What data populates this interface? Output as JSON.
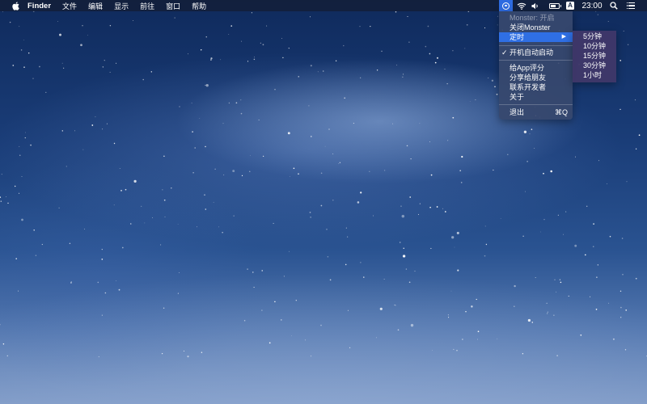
{
  "menubar": {
    "app_name": "Finder",
    "menus": [
      "文件",
      "编辑",
      "显示",
      "前往",
      "窗口",
      "帮助"
    ],
    "status": {
      "input_source": "A",
      "clock": "23:00"
    },
    "icons": [
      "apple-icon",
      "monster-icon",
      "wifi-icon",
      "volume-icon",
      "battery-icon",
      "input-source-icon",
      "spotlight-icon",
      "notification-center-icon"
    ]
  },
  "dropdown": {
    "status_label": "Monster: 开启",
    "close_label": "关闭Monster",
    "timer_label": "定时",
    "autostart_label": "开机自动启动",
    "autostart_checked": true,
    "rate_label": "给App评分",
    "share_label": "分享给朋友",
    "contact_label": "联系开发者",
    "about_label": "关于",
    "quit_label": "退出",
    "quit_shortcut": "⌘Q"
  },
  "submenu": {
    "items": [
      "5分钟",
      "10分钟",
      "15分钟",
      "30分钟",
      "1小时"
    ]
  },
  "colors": {
    "menu_highlight": "#2f6fe4",
    "menubar_bg": "#141e37"
  }
}
